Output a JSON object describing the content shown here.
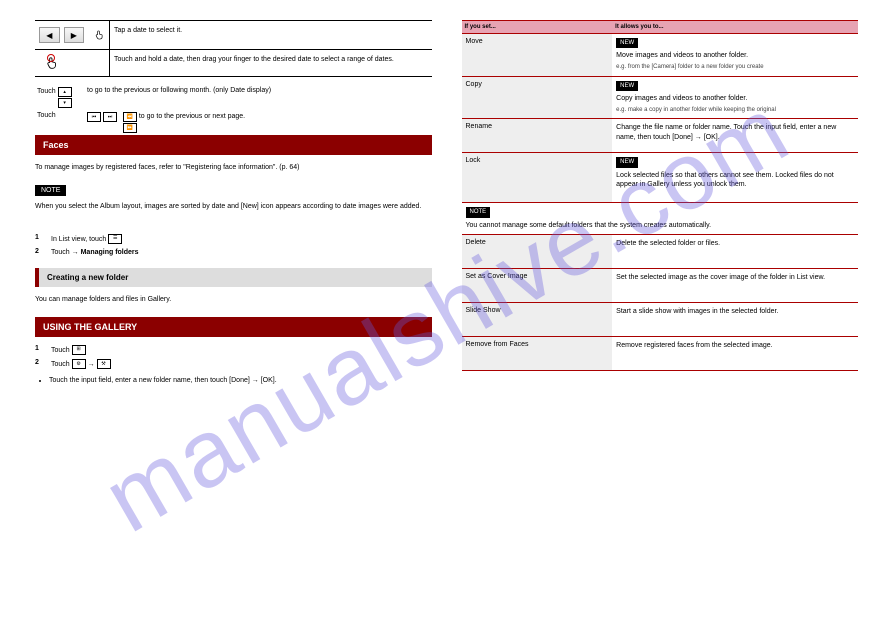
{
  "watermark": "manualshive.com",
  "left": {
    "nav": {
      "prev": "◀",
      "next": "▶"
    },
    "row1_left": "",
    "row1_right": "Tap a date to select it.",
    "row2_left": "",
    "row2_right1": "Touch and hold a date, then drag your finger to the desired date to select a range of dates.",
    "row2_right2": "",
    "footer_l1": "Touch",
    "footer_l2": "Touch",
    "footer_r1": "to go to the previous or following month. (only Date display)",
    "footer_r2": "to go to the previous or next page.",
    "red_section1": "Faces",
    "content1": "To manage images by registered faces, refer to \"Registering face information\". (p. 64)",
    "note_tag": "NOTE",
    "note_body": "When you select the Album layout, images are sorted by date and [New] icon appears according to date images were added.",
    "manage_folders": "Managing folders",
    "manage_folders_body": "You can manage folders and files in Gallery.",
    "step1_n": "1",
    "step1_t": "In List view, touch",
    "step2_n": "2",
    "step2_t": "Touch",
    "step2_t2": "→",
    "gray_bar": "Creating a new folder",
    "red_section2": "USING THE GALLERY",
    "step3_n": "1",
    "step3_t": "Touch",
    "step4_n": "2",
    "step4_t": "Touch",
    "step4_t2": "→",
    "bullet_a": "Touch the input field, enter a new folder name, then touch [Done] → [OK].",
    "bullet_b": ""
  },
  "right": {
    "banner_l": "If you set...",
    "banner_r": "It allows you to...",
    "rows": [
      {
        "c1": "Move",
        "c2_tag": "NEW",
        "c2": "Move images and videos to another folder.",
        "c2_eg": "e.g. from the [Camera] folder to a new folder you create"
      },
      {
        "c1": "Copy",
        "c2_tag": "NEW",
        "c2": "Copy images and videos to another folder.",
        "c2_eg": "e.g. make a copy in another folder while keeping the original"
      },
      {
        "c1": "Rename",
        "c2": "Change the file name or folder name. Touch the input field, enter a new name, then touch [Done] → [OK].",
        "c2_eg": ""
      },
      {
        "c1": "Lock",
        "c2_tag": "NEW",
        "c2": "Lock selected files so that others cannot see them. Locked files do not appear in Gallery unless you unlock them.",
        "c2_eg": ""
      }
    ],
    "note_tag": "NOTE",
    "note_a": "You cannot manage some default folders that the system creates automatically.",
    "note_b": "",
    "spec_rows": [
      {
        "c1": "Delete",
        "c2": "Delete the selected folder or files."
      },
      {
        "c1": "Set as Cover Image",
        "c2": "Set the selected image as the cover image of the folder in List view."
      },
      {
        "c1": "Slide Show",
        "c2": "Start a slide show with images in the selected folder."
      },
      {
        "c1": "Remove from Faces",
        "c2": "Remove registered faces from the selected image."
      }
    ]
  }
}
